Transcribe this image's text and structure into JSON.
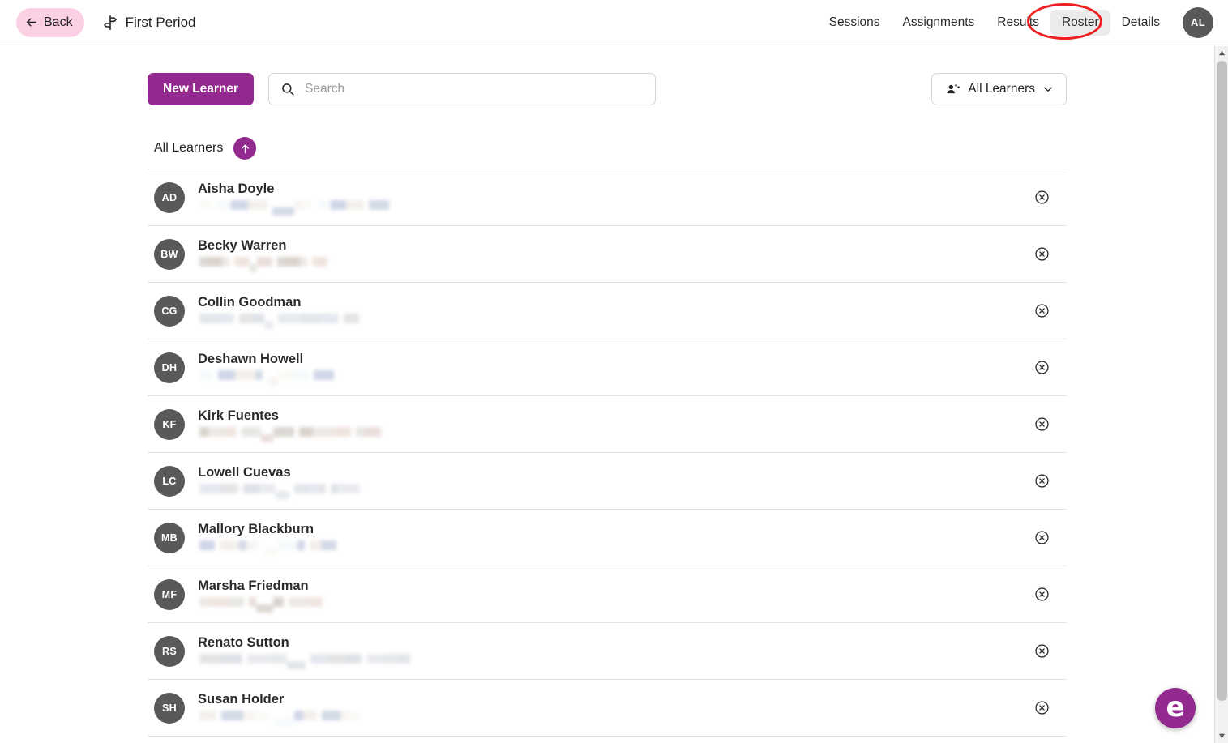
{
  "header": {
    "back_label": "Back",
    "back_icon": "arrow-left-icon",
    "class_icon": "signpost-icon",
    "class_title": "First Period",
    "nav_tabs": [
      {
        "label": "Sessions",
        "active": false
      },
      {
        "label": "Assignments",
        "active": false
      },
      {
        "label": "Results",
        "active": false
      },
      {
        "label": "Roster",
        "active": true
      },
      {
        "label": "Details",
        "active": false
      }
    ],
    "avatar_initials": "AL",
    "annotation": {
      "shape": "ellipse",
      "color": "#ee2020",
      "target": "Roster"
    }
  },
  "toolbar": {
    "new_learner_label": "New Learner",
    "search_icon": "search-icon",
    "search_placeholder": "Search",
    "search_value": "",
    "filter_icon": "people-group-icon",
    "filter_label": "All Learners",
    "filter_chevron_icon": "chevron-down-icon"
  },
  "list": {
    "header_label": "All Learners",
    "sort_badge_icon": "arrow-up-icon",
    "sort_direction": "ascending",
    "remove_icon": "circle-x-icon",
    "learners": [
      {
        "initials": "AD",
        "name": "Aisha Doyle",
        "email_redacted": true
      },
      {
        "initials": "BW",
        "name": "Becky Warren",
        "email_redacted": true
      },
      {
        "initials": "CG",
        "name": "Collin Goodman",
        "email_redacted": true
      },
      {
        "initials": "DH",
        "name": "Deshawn Howell",
        "email_redacted": true
      },
      {
        "initials": "KF",
        "name": "Kirk Fuentes",
        "email_redacted": true
      },
      {
        "initials": "LC",
        "name": "Lowell Cuevas",
        "email_redacted": true
      },
      {
        "initials": "MB",
        "name": "Mallory Blackburn",
        "email_redacted": true
      },
      {
        "initials": "MF",
        "name": "Marsha Friedman",
        "email_redacted": true
      },
      {
        "initials": "RS",
        "name": "Renato Sutton",
        "email_redacted": true
      },
      {
        "initials": "SH",
        "name": "Susan Holder",
        "email_redacted": true
      }
    ]
  },
  "fab": {
    "glyph": "e",
    "icon": "help-widget-icon"
  },
  "scrollbar": {
    "up_icon": "scroll-up-icon",
    "down_icon": "scroll-down-icon"
  },
  "colors": {
    "brand_purple": "#932a8f",
    "back_pink": "#fbcfe4",
    "avatar_gray": "#595959",
    "annotation_red": "#ee2020",
    "divider": "#e4e4e4"
  }
}
